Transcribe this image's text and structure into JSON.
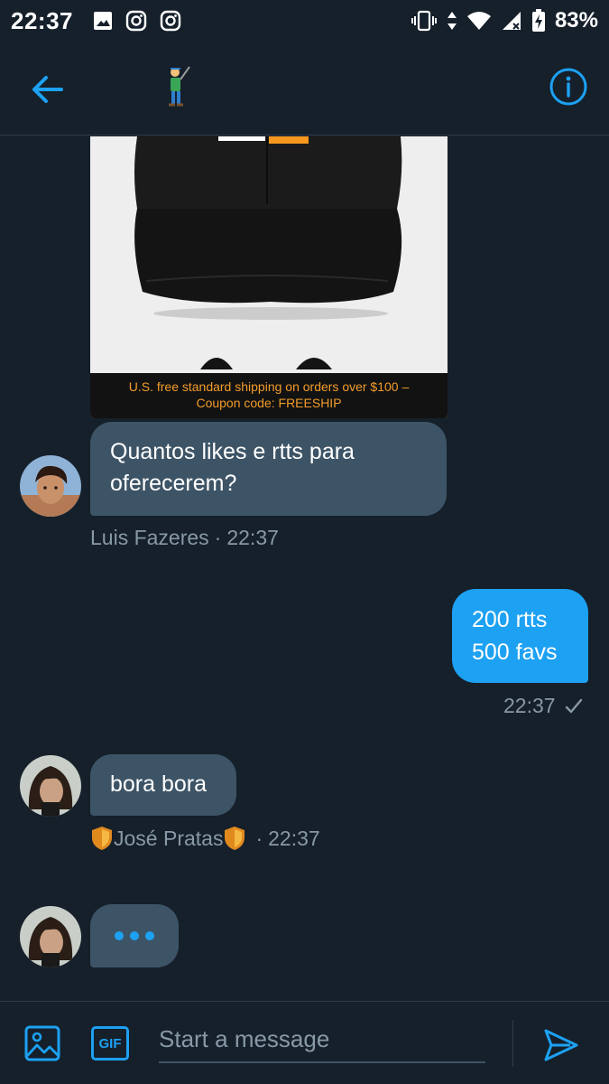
{
  "status_bar": {
    "time": "22:37",
    "battery_percent": "83%"
  },
  "header": {
    "back_icon": "arrow-left-icon",
    "title_emoji": "golfer-emoji",
    "info_icon": "info-icon"
  },
  "messages": {
    "product_banner_line1": "U.S. free standard shipping on orders over $100 –",
    "product_banner_line2": "Coupon code: FREESHIP",
    "msg1": {
      "line1": "Quantos likes e rtts para",
      "line2": "oferecerem?",
      "sender": "Luis Fazeres",
      "time": "22:37"
    },
    "msg2": {
      "line1": "200 rtts",
      "line2": "500 favs",
      "time": "22:37"
    },
    "msg3": {
      "text": "bora bora",
      "sender": "José Pratas",
      "time": "22:37"
    },
    "typing_indicator": "typing"
  },
  "meta_separator": "·",
  "composer": {
    "placeholder": "Start a message",
    "gif_label": "GIF"
  },
  "colors": {
    "background": "#15202b",
    "accent": "#1da1f2",
    "incoming_bubble": "#3d5466",
    "muted_text": "#8899a6"
  }
}
